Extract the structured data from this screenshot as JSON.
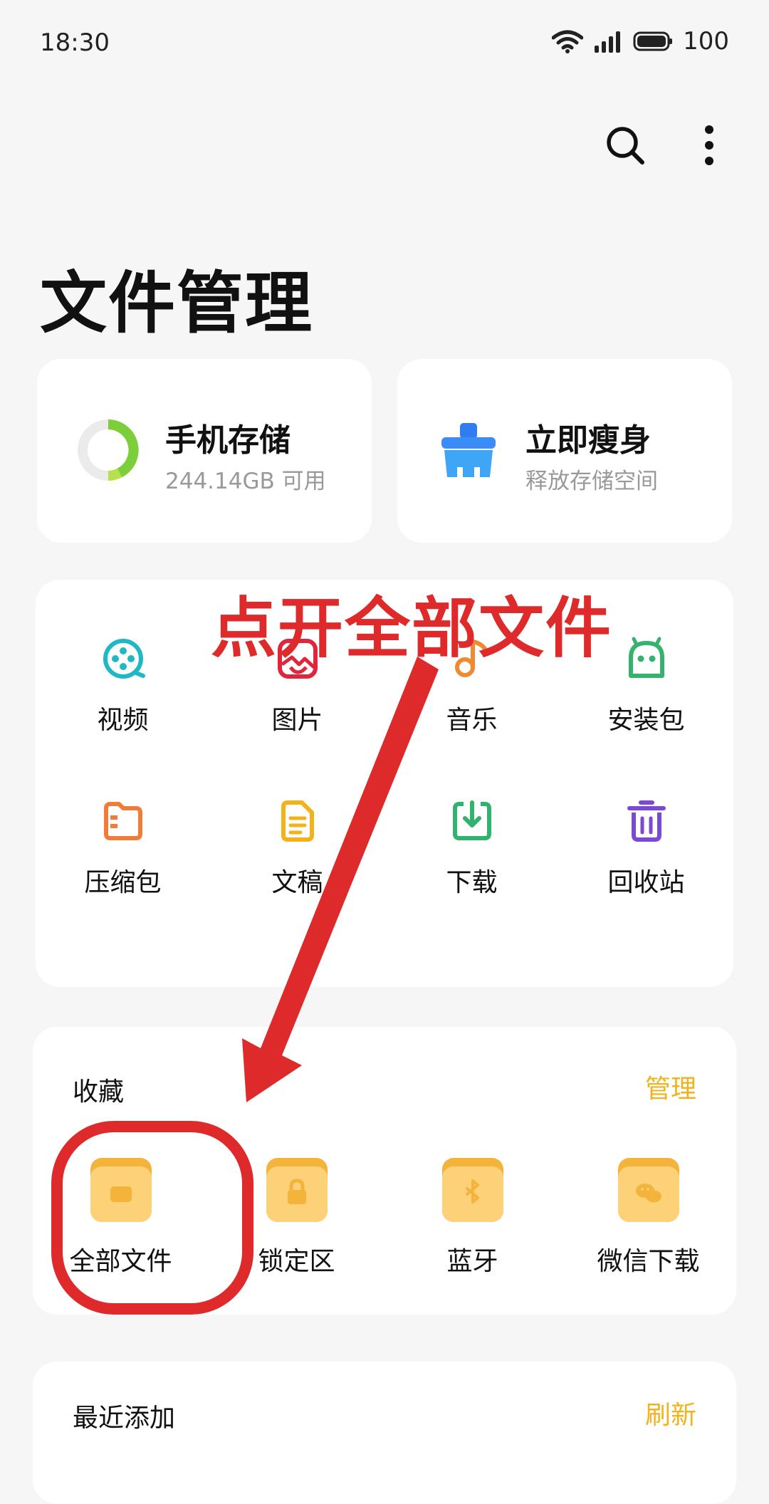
{
  "status": {
    "time": "18:30",
    "battery": "100"
  },
  "header": {
    "title": "文件管理"
  },
  "storage": {
    "title": "手机存储",
    "subtitle": "244.14GB 可用"
  },
  "slim": {
    "title": "立即瘦身",
    "subtitle": "释放存储空间"
  },
  "categories": [
    {
      "label": "视频",
      "icon": "video-icon",
      "color": "#1fb8c4"
    },
    {
      "label": "图片",
      "icon": "image-icon",
      "color": "#e0263b"
    },
    {
      "label": "音乐",
      "icon": "music-icon",
      "color": "#f08a32"
    },
    {
      "label": "安装包",
      "icon": "android-icon",
      "color": "#33b36b"
    },
    {
      "label": "压缩包",
      "icon": "archive-icon",
      "color": "#f07c3a"
    },
    {
      "label": "文稿",
      "icon": "document-icon",
      "color": "#f2b21a"
    },
    {
      "label": "下载",
      "icon": "download-icon",
      "color": "#2fb36e"
    },
    {
      "label": "回收站",
      "icon": "trash-icon",
      "color": "#7b49d3"
    }
  ],
  "favorites": {
    "title": "收藏",
    "manage": "管理",
    "items": [
      {
        "label": "全部文件",
        "icon": "all-files-folder-icon"
      },
      {
        "label": "锁定区",
        "icon": "lock-folder-icon"
      },
      {
        "label": "蓝牙",
        "icon": "bluetooth-folder-icon"
      },
      {
        "label": "微信下载",
        "icon": "wechat-folder-icon"
      }
    ]
  },
  "recent": {
    "title": "最近添加",
    "refresh": "刷新"
  },
  "annotation": {
    "text": "点开全部文件",
    "color": "#de2a2a"
  }
}
